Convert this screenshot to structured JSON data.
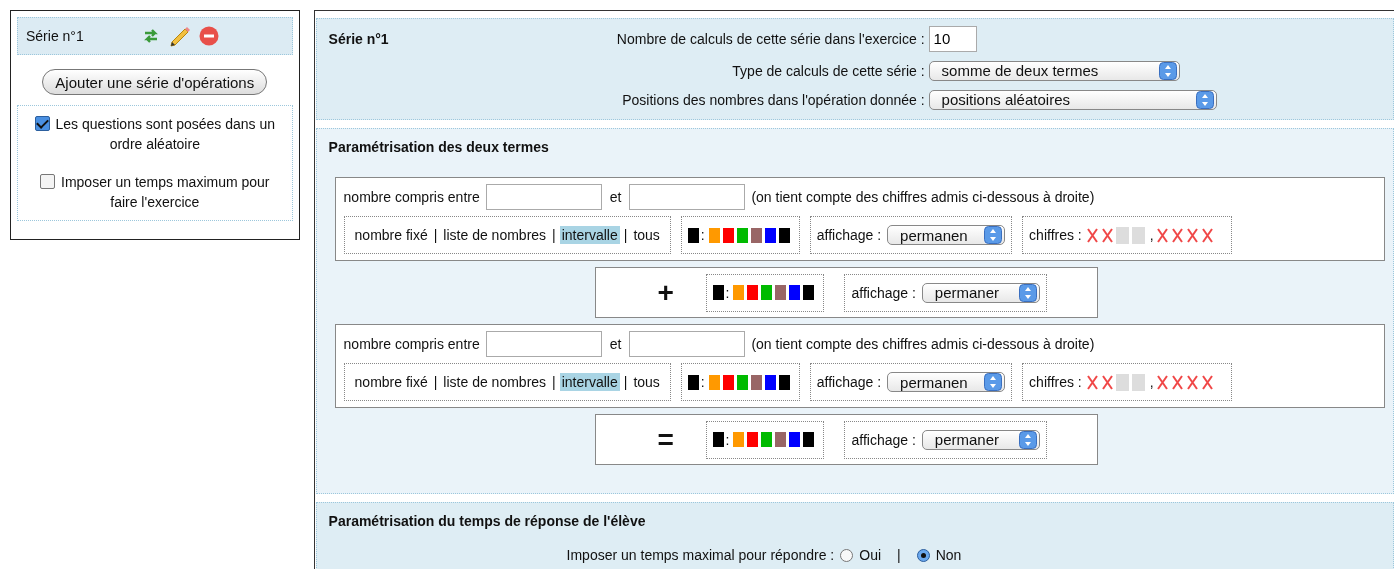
{
  "sidebar": {
    "series": [
      {
        "label": "Série n°1",
        "selected": true
      }
    ],
    "add_button": "Ajouter une série d'opérations",
    "options": [
      {
        "label": "Les questions sont posées dans un ordre aléatoire",
        "checked": true
      },
      {
        "label": "Imposer un temps maximum pour faire l'exercice",
        "checked": false
      }
    ]
  },
  "series_panel": {
    "title": "Série n°1",
    "fields": [
      {
        "kind": "input",
        "label": "Nombre de calculs de cette série dans l'exercice :",
        "value": "10"
      },
      {
        "kind": "select",
        "label": "Type de calculs de cette série :",
        "value": "somme de deux termes"
      },
      {
        "kind": "select",
        "label": "Positions des nombres dans l'opération donnée :",
        "value": "positions aléatoires"
      }
    ]
  },
  "terms_panel": {
    "title": "Paramétrisation des deux termes",
    "blocks": [
      {
        "kind": "term",
        "range_label": "nombre compris entre",
        "and_label": "et",
        "note": "(on tient compte des chiffres admis ci-dessous à droite)",
        "separator": "|",
        "modes": [
          {
            "label": "nombre fixé",
            "selected": false
          },
          {
            "label": "liste de nombres",
            "selected": false
          },
          {
            "label": "intervalle",
            "selected": true
          },
          {
            "label": "tous",
            "selected": false
          }
        ],
        "current": {
          "color": "#000000"
        },
        "color_separator": ":",
        "palette": [
          {
            "color": "#ff9900"
          },
          {
            "color": "#ff0000"
          },
          {
            "color": "#00bb00"
          },
          {
            "color": "#996666"
          },
          {
            "color": "#0000ff"
          },
          {
            "color": "#000000"
          }
        ],
        "display_label": "affichage :",
        "display_value": "permanen",
        "digits_label": "chiffres :",
        "integer_digits": [
          {
            "crossed": true
          },
          {
            "crossed": true
          },
          {
            "crossed": false
          },
          {
            "crossed": false
          }
        ],
        "decimal_separator": ",",
        "decimal_digits": [
          {
            "crossed": true
          },
          {
            "crossed": true
          },
          {
            "crossed": true
          },
          {
            "crossed": true
          }
        ]
      },
      {
        "kind": "operator",
        "symbol": "+",
        "current": {
          "color": "#000000"
        },
        "color_separator": ":",
        "palette": [
          {
            "color": "#ff9900"
          },
          {
            "color": "#ff0000"
          },
          {
            "color": "#00bb00"
          },
          {
            "color": "#996666"
          },
          {
            "color": "#0000ff"
          },
          {
            "color": "#000000"
          }
        ],
        "display_label": "affichage :",
        "display_value": "permaner"
      },
      {
        "kind": "term",
        "range_label": "nombre compris entre",
        "and_label": "et",
        "note": "(on tient compte des chiffres admis ci-dessous à droite)",
        "separator": "|",
        "modes": [
          {
            "label": "nombre fixé",
            "selected": false
          },
          {
            "label": "liste de nombres",
            "selected": false
          },
          {
            "label": "intervalle",
            "selected": true
          },
          {
            "label": "tous",
            "selected": false
          }
        ],
        "current": {
          "color": "#000000"
        },
        "color_separator": ":",
        "palette": [
          {
            "color": "#ff9900"
          },
          {
            "color": "#ff0000"
          },
          {
            "color": "#00bb00"
          },
          {
            "color": "#996666"
          },
          {
            "color": "#0000ff"
          },
          {
            "color": "#000000"
          }
        ],
        "display_label": "affichage :",
        "display_value": "permanen",
        "digits_label": "chiffres :",
        "integer_digits": [
          {
            "crossed": true
          },
          {
            "crossed": true
          },
          {
            "crossed": false
          },
          {
            "crossed": false
          }
        ],
        "decimal_separator": ",",
        "decimal_digits": [
          {
            "crossed": true
          },
          {
            "crossed": true
          },
          {
            "crossed": true
          },
          {
            "crossed": true
          }
        ]
      },
      {
        "kind": "operator",
        "symbol": "=",
        "current": {
          "color": "#000000"
        },
        "color_separator": ":",
        "palette": [
          {
            "color": "#ff9900"
          },
          {
            "color": "#ff0000"
          },
          {
            "color": "#00bb00"
          },
          {
            "color": "#996666"
          },
          {
            "color": "#0000ff"
          },
          {
            "color": "#000000"
          }
        ],
        "display_label": "affichage :",
        "display_value": "permaner"
      }
    ]
  },
  "time_panel": {
    "title": "Paramétrisation du temps de réponse de l'élève",
    "question": "Imposer un temps maximal pour répondre :",
    "separator": "|",
    "options": [
      {
        "label": "Oui",
        "selected": false
      },
      {
        "label": "Non",
        "selected": true
      }
    ]
  }
}
